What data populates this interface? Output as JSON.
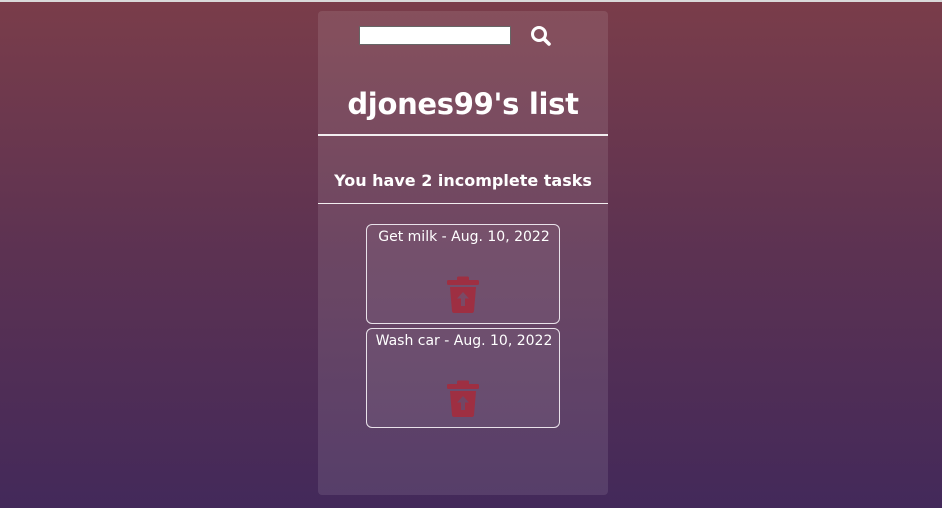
{
  "search": {
    "placeholder": "",
    "value": "",
    "icon": "search-icon"
  },
  "header": {
    "title": "djones99's list"
  },
  "summary": {
    "text": "You have 2 incomplete tasks"
  },
  "tasks": [
    {
      "label": "Get milk - Aug. 10, 2022",
      "icon": "trash-restore-icon"
    },
    {
      "label": "Wash car - Aug. 10, 2022",
      "icon": "trash-restore-icon"
    }
  ],
  "colors": {
    "trash_icon": "#9e2f42",
    "text": "#ffffff"
  }
}
